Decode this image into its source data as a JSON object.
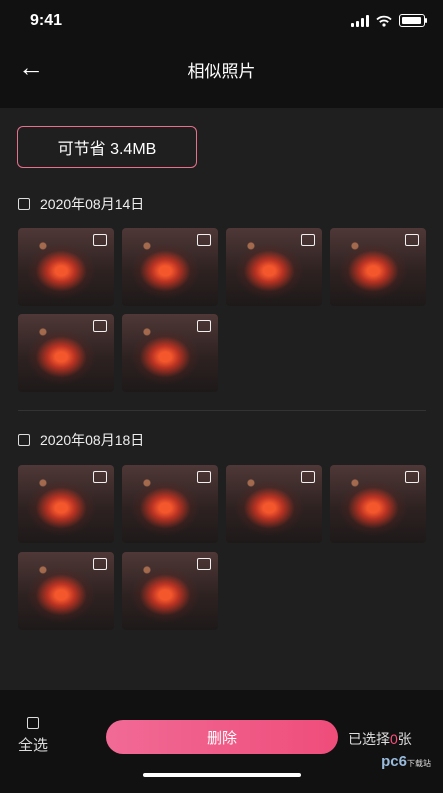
{
  "status": {
    "time": "9:41"
  },
  "nav": {
    "back_icon": "←",
    "title": "相似照片"
  },
  "savings": {
    "label": "可节省 3.4MB"
  },
  "groups": [
    {
      "date": "2020年08月14日",
      "photos": [
        "photo-1",
        "photo-2",
        "photo-3",
        "photo-4",
        "photo-5",
        "photo-6"
      ]
    },
    {
      "date": "2020年08月18日",
      "photos": [
        "photo-1",
        "photo-2",
        "photo-3",
        "photo-4",
        "photo-5",
        "photo-6"
      ]
    }
  ],
  "bottom": {
    "select_all_label": "全选",
    "delete_label": "删除",
    "selected_prefix": "已选择",
    "selected_count": "0",
    "selected_suffix": "张"
  },
  "watermark": {
    "text": "pc6",
    "sub": "下载站"
  },
  "colors": {
    "accent": "#ef4d7a",
    "border": "#e7718d",
    "background": "#1f1f1f",
    "bar": "#111111"
  }
}
